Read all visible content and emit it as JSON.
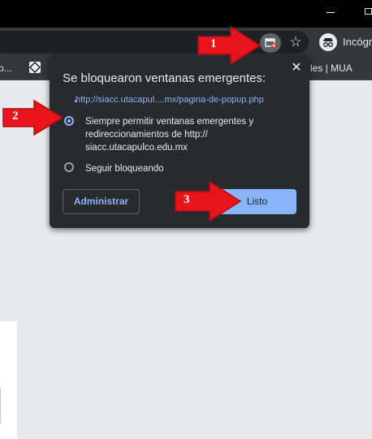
{
  "browser": {
    "incognito_label": "Incógn",
    "bookmarks": {
      "left_label": "p...",
      "right_label": "les | MUA"
    }
  },
  "popup_bubble": {
    "title": "Se bloquearon ventanas emergentes:",
    "popup_link": "http://siacc.utacapul....mx/pagina-de-popup.php",
    "options": [
      {
        "label": "Siempre permitir ventanas emergentes y redireccionamientos de http:// siacc.utacapulco.edu.mx",
        "selected": true
      },
      {
        "label": "Seguir bloqueando",
        "selected": false
      }
    ],
    "manage_button": "Administrar",
    "done_button": "Listo"
  },
  "annotations": [
    {
      "label": "1",
      "color": "#e8141b"
    },
    {
      "label": "2",
      "color": "#e8141b"
    },
    {
      "label": "3",
      "color": "#e8141b"
    }
  ],
  "icons": [
    "popup-blocked-icon",
    "star-icon",
    "incognito-icon",
    "close-icon",
    "bookmark-favicon"
  ]
}
